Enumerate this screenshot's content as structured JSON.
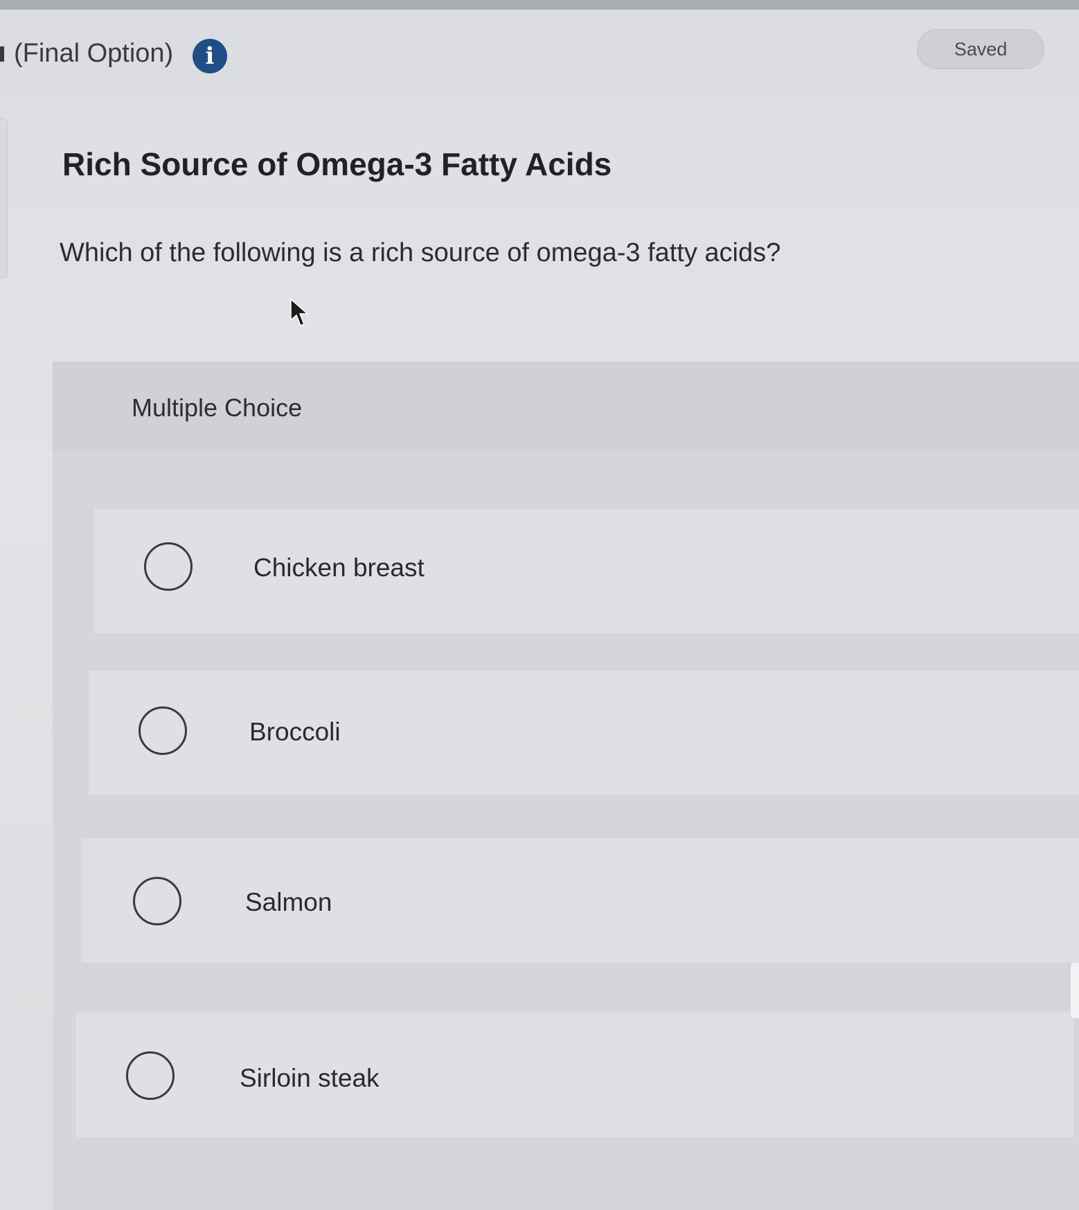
{
  "header": {
    "title": "(Final Option)",
    "info_icon": "info-icon",
    "status": "Saved"
  },
  "question": {
    "title": "Rich Source of Omega-3 Fatty Acids",
    "prompt": "Which of the following is a rich source of omega-3 fatty acids?",
    "type_label": "Multiple Choice",
    "options": [
      {
        "label": "Chicken breast",
        "selected": false
      },
      {
        "label": "Broccoli",
        "selected": false
      },
      {
        "label": "Salmon",
        "selected": false
      },
      {
        "label": "Sirloin steak",
        "selected": false
      }
    ]
  },
  "colors": {
    "accent": "#1f4e86",
    "background": "#dedfe3",
    "text": "#222226"
  }
}
